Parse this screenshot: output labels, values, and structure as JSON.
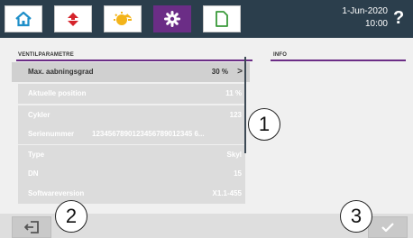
{
  "header": {
    "tabs": [
      {
        "icon": "home-icon"
      },
      {
        "icon": "arrows-icon"
      },
      {
        "icon": "sun-icon"
      },
      {
        "icon": "gear-icon",
        "active": true
      },
      {
        "icon": "sd-card-icon"
      }
    ],
    "date": "1-Jun-2020",
    "time": "10:00",
    "help_label": "?"
  },
  "left_section": {
    "title": "VENTILPARAMETRE",
    "rows": [
      {
        "label": "Max. aabningsgrad",
        "value": "30 %"
      },
      {
        "label": "Aktuelle position",
        "value": "11 %"
      },
      {
        "label": "Cykler",
        "value": "123"
      },
      {
        "label": "Serienummer",
        "value": "1234567890123456789012345 6..."
      },
      {
        "label": "Type",
        "value": "Skyl"
      },
      {
        "label": "DN",
        "value": "15"
      },
      {
        "label": "Softwareversion",
        "value": "X1.1-455"
      }
    ]
  },
  "right_section": {
    "title": "INFO"
  },
  "callouts": [
    "1",
    "2",
    "3"
  ],
  "colors": {
    "header_bg": "#2b3e4c",
    "accent": "#6b2d86"
  }
}
